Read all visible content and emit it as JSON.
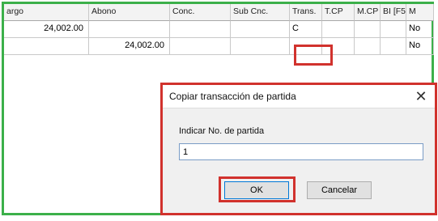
{
  "grid": {
    "columns": [
      "argo",
      "Abono",
      "Conc.",
      "Sub Cnc.",
      "Trans.",
      "T.CP",
      "M.CP",
      "BI [F5]",
      "M"
    ],
    "rows": [
      [
        "24,002.00",
        "",
        "",
        "",
        "C",
        "",
        "",
        "",
        "No"
      ],
      [
        "",
        "24,002.00",
        "",
        "",
        "",
        "",
        "",
        "",
        "No"
      ]
    ]
  },
  "dialog": {
    "title": "Copiar transacción de partida",
    "prompt": "Indicar No. de partida",
    "input_value": "1",
    "ok_label": "OK",
    "cancel_label": "Cancelar",
    "close_glyph": "✕"
  },
  "colors": {
    "frame": "#3cb04a",
    "highlight": "#d1322d"
  }
}
